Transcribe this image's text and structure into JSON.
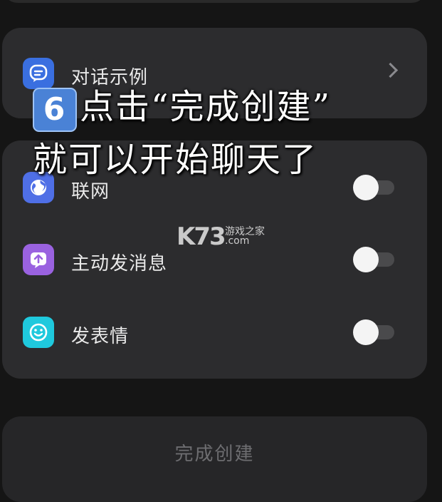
{
  "examples_card": {
    "label": "对话示例",
    "icon": "chat-bubble-icon",
    "icon_color": "#3a6fe0"
  },
  "toggles": [
    {
      "label": "联网",
      "icon": "globe-icon",
      "icon_color": "#4f6fe6",
      "enabled": false
    },
    {
      "label": "主动发消息",
      "icon": "upload-message-icon",
      "icon_color": "#9a62e0",
      "enabled": false
    },
    {
      "label": "发表情",
      "icon": "smiley-icon",
      "icon_color": "#1fc9dd",
      "enabled": false
    }
  ],
  "done_button": {
    "label": "完成创建"
  },
  "overlay": {
    "step_number": "6",
    "line1": "点击“完成创建”",
    "line2": "就可以开始聊天了"
  },
  "watermark": {
    "brand": "K73",
    "tagline": "游戏之家",
    "domain": ".com"
  }
}
